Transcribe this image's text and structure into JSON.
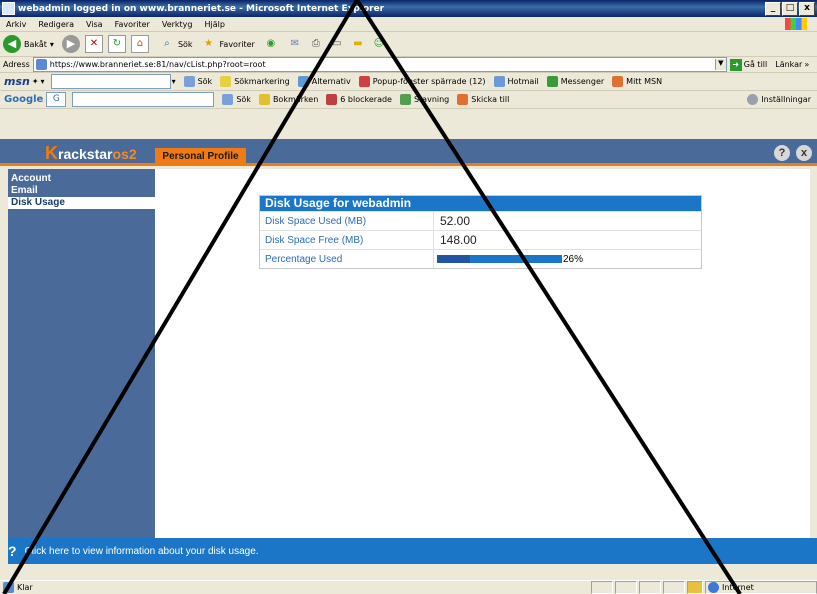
{
  "window": {
    "title": "webadmin logged in on www.branneriet.se - Microsoft Internet Explorer",
    "buttons": [
      "_",
      "□",
      "x"
    ]
  },
  "menubar": {
    "items": [
      "Arkiv",
      "Redigera",
      "Visa",
      "Favoriter",
      "Verktyg",
      "Hjälp"
    ]
  },
  "navbar": {
    "back_label": "Bakåt",
    "search_label": "Sök",
    "favorites_label": "Favoriter"
  },
  "addressbar": {
    "label": "Adress",
    "url": "https://www.branneriet.se:81/nav/cList.php?root=root",
    "go_label": "Gå till",
    "links_label": "Länkar"
  },
  "msnbar": {
    "logo": "msn",
    "search_label": "Sök",
    "highlight_label": "Sökmarkering",
    "alternatives_label": "Alternativ",
    "popup_label": "Popup-fönster spärrade (12)",
    "hotmail_label": "Hotmail",
    "messenger_label": "Messenger",
    "mymsn_label": "Mitt MSN"
  },
  "googlebar": {
    "logo": "Google",
    "g_label": "G",
    "search_label": "Sök",
    "bookmarks_label": "Bokmärken",
    "blocked_label": "6 blockerade",
    "spelling_label": "Stavning",
    "send_label": "Skicka till",
    "settings_label": "Inställningar"
  },
  "app": {
    "logo_k": "K",
    "logo_text": "rackstar",
    "logo_os": "os2",
    "tab_label": "Personal Profile",
    "help_icon": "?",
    "close_icon": "x",
    "sidebar": [
      {
        "label": "Account",
        "active": false
      },
      {
        "label": "Email",
        "active": false
      },
      {
        "label": "Disk Usage",
        "active": true
      }
    ],
    "disk": {
      "title": "Disk Usage for webadmin",
      "rows": [
        {
          "label": "Disk Space Used (MB)",
          "value": "52.00"
        },
        {
          "label": "Disk Space Free (MB)",
          "value": "148.00"
        }
      ],
      "percentage_label": "Percentage Used",
      "percentage_text": "26%",
      "percentage_value": 26
    },
    "help_text": "Click here to view information about your disk usage.",
    "help_q": "?"
  },
  "statusbar": {
    "left": "Klar",
    "zone": "Internet"
  },
  "colors": {
    "app_header": "#4a6b9a",
    "accent": "#f07b14",
    "table_header": "#1c76c8",
    "label_text": "#2c6db8"
  }
}
